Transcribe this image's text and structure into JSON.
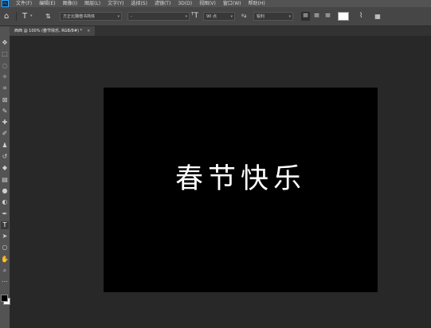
{
  "app": {
    "logo_text": "Ps"
  },
  "menu": [
    "文件(F)",
    "编辑(E)",
    "图像(I)",
    "图层(L)",
    "文字(Y)",
    "选择(S)",
    "滤镜(T)",
    "3D(D)",
    "视图(V)",
    "窗口(W)",
    "帮助(H)"
  ],
  "options": {
    "font_family": "方正北魏楷书简体",
    "font_style": "-",
    "font_size": "90 点",
    "antialias": "锐利",
    "text_color": "#ffffff"
  },
  "document": {
    "tab_label": "西西 @ 100% (春节快乐, RGB/8#) *",
    "close_label": "×",
    "canvas_text": "春节快乐"
  },
  "icons": {
    "home": "home-icon",
    "text_tool": "text-tool-icon",
    "orientation": "text-orientation-icon",
    "align_left": "align-left-icon",
    "align_center": "align-center-icon",
    "align_right": "align-right-icon",
    "warp": "warp-text-icon",
    "panels": "character-panel-icon"
  },
  "toolbar": {
    "tools": [
      {
        "name": "move-tool-icon",
        "glyph": "✥"
      },
      {
        "name": "marquee-tool-icon",
        "glyph": "⬚"
      },
      {
        "name": "lasso-tool-icon",
        "glyph": "◌"
      },
      {
        "name": "magic-wand-tool-icon",
        "glyph": "✧"
      },
      {
        "name": "crop-tool-icon",
        "glyph": "⌗"
      },
      {
        "name": "frame-tool-icon",
        "glyph": "⊠"
      },
      {
        "name": "eyedropper-tool-icon",
        "glyph": "✎"
      },
      {
        "name": "healing-brush-tool-icon",
        "glyph": "✚"
      },
      {
        "name": "brush-tool-icon",
        "glyph": "✐"
      },
      {
        "name": "clone-stamp-tool-icon",
        "glyph": "♟"
      },
      {
        "name": "history-brush-tool-icon",
        "glyph": "↺"
      },
      {
        "name": "eraser-tool-icon",
        "glyph": "◆"
      },
      {
        "name": "gradient-tool-icon",
        "glyph": "▤"
      },
      {
        "name": "blur-tool-icon",
        "glyph": "●"
      },
      {
        "name": "dodge-tool-icon",
        "glyph": "◐"
      },
      {
        "name": "pen-tool-icon",
        "glyph": "✒"
      },
      {
        "name": "type-tool-icon",
        "glyph": "T",
        "active": true
      },
      {
        "name": "path-selection-tool-icon",
        "glyph": "➤"
      },
      {
        "name": "shape-tool-icon",
        "glyph": "○"
      },
      {
        "name": "hand-tool-icon",
        "glyph": "✋"
      },
      {
        "name": "zoom-tool-icon",
        "glyph": "⌕"
      },
      {
        "name": "more-tools-icon",
        "glyph": "⋯"
      }
    ]
  },
  "colors": {
    "foreground": "#000000",
    "background": "#ffffff"
  }
}
